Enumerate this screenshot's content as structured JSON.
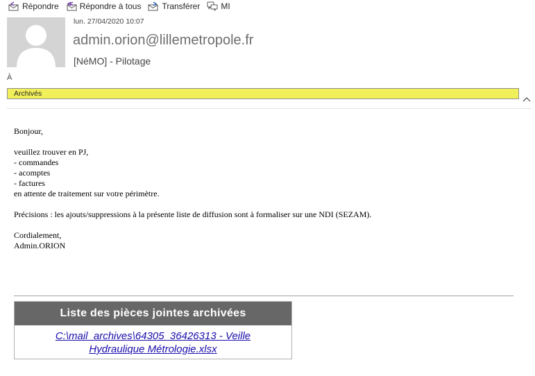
{
  "toolbar": {
    "reply": "Répondre",
    "reply_all": "Répondre à tous",
    "forward": "Transférer",
    "im": "MI"
  },
  "message": {
    "date": "lun. 27/04/2020 10:07",
    "sender": "admin.orion@lillemetropole.fr",
    "subject": "[NéMO] - Pilotage",
    "to_label": "À",
    "category": "Archivés"
  },
  "body": {
    "greeting": "Bonjour,",
    "lines": [
      "veuillez trouver en PJ,",
      "- commandes",
      "- acomptes",
      "- factures",
      "en attente de traitement sur votre périmètre."
    ],
    "precisions": "Précisions : les ajouts/suppressions à la présente liste de diffusion sont à formaliser sur une NDI (SEZAM).",
    "closing": "Cordialement,",
    "signature": "Admin.ORION"
  },
  "attachments": {
    "header": "Liste des pièces jointes archivées",
    "link": "C:\\mail_archives\\64305_36426313 - Veille Hydraulique Métrologie.xlsx"
  },
  "colors": {
    "category_bg": "#f2f05a",
    "attachment_header_bg": "#676767",
    "link": "#1a0dab"
  }
}
